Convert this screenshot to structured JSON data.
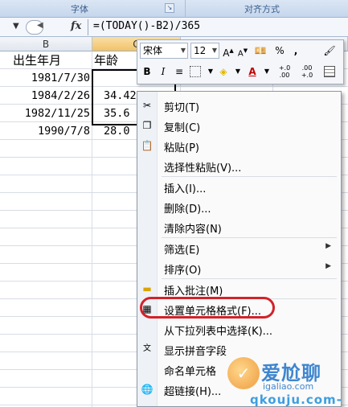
{
  "ribbon": {
    "font_group": "字体",
    "align_group": "对齐方式"
  },
  "formula_bar": {
    "fx_label": "fx",
    "formula": "=(TODAY()-B2)/365"
  },
  "grid": {
    "col_b": "B",
    "col_c": "C",
    "rows": [
      {
        "b": "出生年月",
        "c": "年龄"
      },
      {
        "b": "1981/7/30",
        "c": ""
      },
      {
        "b": "1984/2/26",
        "c": "34.42191781"
      },
      {
        "b": "1982/11/25",
        "c": "35.6"
      },
      {
        "b": "1990/7/8",
        "c": "28.0"
      }
    ]
  },
  "mini_toolbar": {
    "font_name": "宋体",
    "font_size": "12",
    "bold": "B",
    "italic": "I",
    "align": "≡",
    "percent": "%",
    "comma": ",",
    "inc_decimal": "+.0 .00",
    "dec_decimal": ".00 +.0"
  },
  "context_menu": {
    "items": [
      {
        "label": "剪切(T)",
        "icon": "scissors-icon"
      },
      {
        "label": "复制(C)",
        "icon": "copy-icon"
      },
      {
        "label": "粘贴(P)",
        "icon": "paste-icon"
      },
      {
        "label": "选择性粘贴(V)..."
      },
      {
        "label": "插入(I)..."
      },
      {
        "label": "删除(D)..."
      },
      {
        "label": "清除内容(N)"
      },
      {
        "label": "筛选(E)"
      },
      {
        "label": "排序(O)"
      },
      {
        "label": "插入批注(M)",
        "icon": "comment-icon"
      },
      {
        "label": "设置单元格格式(F)...",
        "icon": "format-cells-icon"
      },
      {
        "label": "从下拉列表中选择(K)..."
      },
      {
        "label": "显示拼音字段",
        "icon": "phonetic-icon"
      },
      {
        "label": "命名单元格"
      },
      {
        "label": "超链接(H)...",
        "icon": "hyperlink-icon"
      }
    ]
  },
  "watermark": {
    "brand": "爱尬聊",
    "url": "igaliao.com",
    "url2": "qkouju.com-"
  },
  "colors": {
    "highlight_oval": "#d3222a",
    "selected_col_header": "#f0c36a"
  }
}
